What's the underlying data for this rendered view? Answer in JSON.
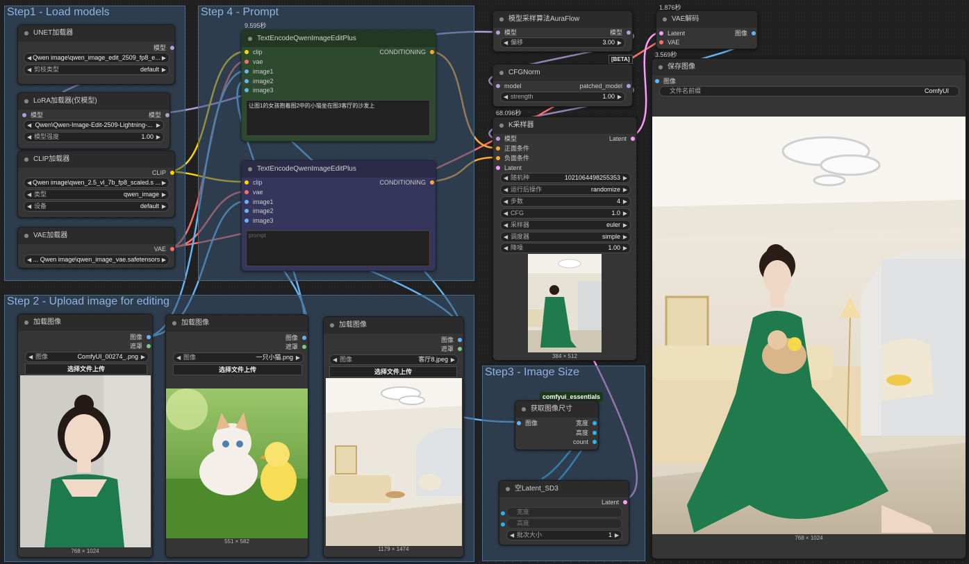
{
  "colors": {
    "model": "#b39ddb",
    "clip": "#ffd500",
    "vae": "#ff6e6e",
    "image": "#64b5f6",
    "conditioning": "#ffa931",
    "latent": "#ff9cf9",
    "mask": "#81c784",
    "int": "#29b6f6"
  },
  "groups": {
    "load_models": "Step1 - Load models",
    "prompt": "Step 4 - Prompt",
    "upload": "Step 2 - Upload image for editing",
    "image_size": "Step3 - Image Size"
  },
  "unet": {
    "title": "UNET加载器",
    "out": "模型",
    "w1_value": "Qwen image\\qwen_image_edit_2509_fp8_e...",
    "w2_label": "剪枝类型",
    "w2_value": "default"
  },
  "lora": {
    "title": "LoRA加载器(仅模型)",
    "in": "模型",
    "out": "模型",
    "w1_value": "Qwen\\Qwen-Image-Edit-2509-Lightning-...",
    "w2_label": "模型强度",
    "w2_value": "1.00"
  },
  "clip": {
    "title": "CLIP加载器",
    "out": "CLIP",
    "w1_value": "Qwen image\\qwen_2.5_vl_7b_fp8_scaled.s ...",
    "w2_label": "类型",
    "w2_value": "qwen_image",
    "w3_label": "设备",
    "w3_value": "default"
  },
  "vae_loader": {
    "title": "VAE加载器",
    "out": "VAE",
    "w1_value": "... Qwen image\\qwen_image_vae.safetensors"
  },
  "te1": {
    "badge": "9.595秒",
    "title": "TextEncodeQwenImageEditPlus",
    "inputs": [
      "clip",
      "vae",
      "image1",
      "image2",
      "image3"
    ],
    "out": "CONDITIONING",
    "text": "让图1的女孩抱着图2中的小猫坐在图3客厅的沙发上"
  },
  "te2": {
    "title": "TextEncodeQwenImageEditPlus",
    "inputs": [
      "clip",
      "vae",
      "image1",
      "image2",
      "image3"
    ],
    "out": "CONDITIONING",
    "placeholder": "prompt"
  },
  "aura": {
    "title": "模型采样算法AuraFlow",
    "in": "模型",
    "out": "模型",
    "w_label": "偏移",
    "w_value": "3.00"
  },
  "beta": "[BETA]",
  "cfgnorm": {
    "title": "CFGNorm",
    "in": "model",
    "out": "patched_model",
    "w_label": "strength",
    "w_value": "1.00"
  },
  "ksampler": {
    "badge": "68.096秒",
    "title": "K采样器",
    "inputs": [
      "模型",
      "正面条件",
      "负面条件",
      "Latent"
    ],
    "out": "Latent",
    "widgets": [
      [
        "随机种",
        "1021064498255353"
      ],
      [
        "运行后操作",
        "randomize"
      ],
      [
        "步数",
        "4"
      ],
      [
        "CFG",
        "1.0"
      ],
      [
        "采样器",
        "euler"
      ],
      [
        "调度器",
        "simple"
      ],
      [
        "降噪",
        "1.00"
      ]
    ],
    "dim": "384 × 512"
  },
  "vae_decode": {
    "badge": "1.876秒",
    "title": "VAE解码",
    "inputs": [
      "Latent",
      "VAE"
    ],
    "out": "图像"
  },
  "save": {
    "badge": "3.569秒",
    "title": "保存图像",
    "in": "图像",
    "w_label": "文件名前缀",
    "w_value": "ComfyUI",
    "dim": "768 × 1024"
  },
  "load1": {
    "title": "加载图像",
    "out1": "图像",
    "out2": "遮罩",
    "w_label": "图像",
    "w_value": "ComfyUI_00274_.png",
    "upload": "选择文件上传",
    "dim": "768 × 1024"
  },
  "load2": {
    "title": "加载图像",
    "out1": "图像",
    "out2": "遮罩",
    "w_label": "图像",
    "w_value": "一只小猫.png",
    "upload": "选择文件上传",
    "dim": "551 × 582"
  },
  "load3": {
    "title": "加载图像",
    "out1": "图像",
    "out2": "遮罩",
    "w_label": "图像",
    "w_value": "客厅8.jpeg",
    "upload": "选择文件上传",
    "dim": "1179 × 1474"
  },
  "getsize": {
    "tag": "comfyui_essentials",
    "title": "获取图像尺寸",
    "in": "图像",
    "outs": [
      "宽度",
      "高度",
      "count"
    ]
  },
  "latent_sd3": {
    "title": "空Latent_SD3",
    "out": "Latent",
    "w1_label": "宽度",
    "w2_label": "高度",
    "w3_label": "批次大小",
    "w3_value": "1"
  }
}
